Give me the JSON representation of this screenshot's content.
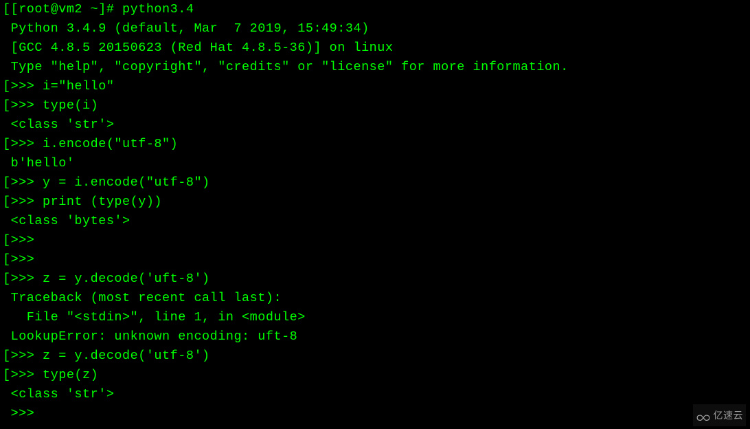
{
  "terminal": {
    "lines": [
      "[[root@vm2 ~]# python3.4",
      " Python 3.4.9 (default, Mar  7 2019, 15:49:34)",
      " [GCC 4.8.5 20150623 (Red Hat 4.8.5-36)] on linux",
      " Type \"help\", \"copyright\", \"credits\" or \"license\" for more information.",
      "[>>> i=\"hello\"",
      "[>>> type(i)",
      " <class 'str'>",
      "[>>> i.encode(\"utf-8\")",
      " b'hello'",
      "[>>> y = i.encode(\"utf-8\")",
      "[>>> print (type(y))",
      " <class 'bytes'>",
      "[>>>",
      "[>>>",
      "[>>> z = y.decode('uft-8')",
      " Traceback (most recent call last):",
      "   File \"<stdin>\", line 1, in <module>",
      " LookupError: unknown encoding: uft-8",
      "[>>> z = y.decode('utf-8')",
      "[>>> type(z)",
      " <class 'str'>",
      " >>>"
    ]
  },
  "watermark": {
    "text": "亿速云"
  }
}
